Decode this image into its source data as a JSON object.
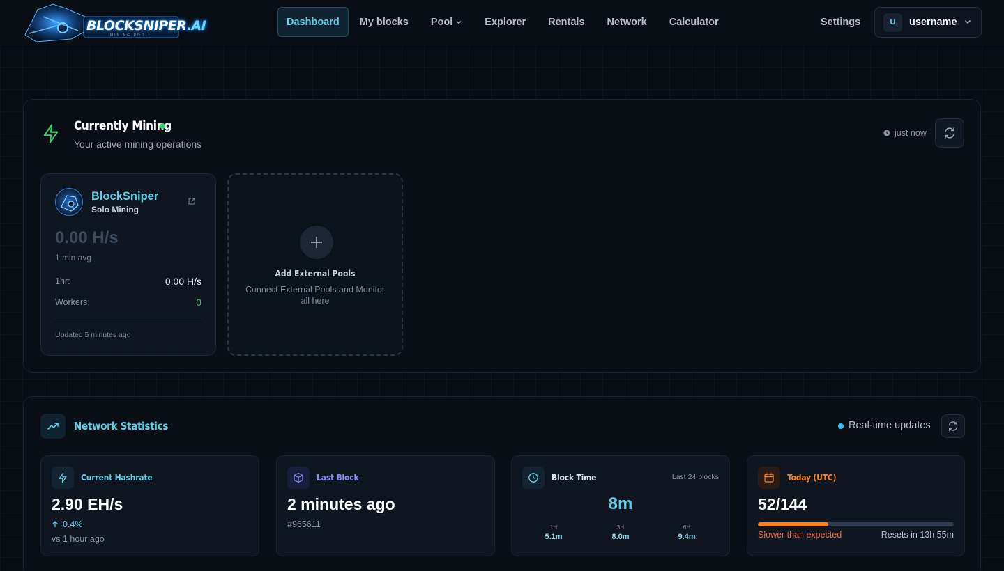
{
  "brand": {
    "logo_text": "BLOCKSNIPER",
    "logo_ai": ".AI",
    "logo_sub": "MINING POOL"
  },
  "nav": {
    "links": [
      {
        "label": "Dashboard",
        "active": true
      },
      {
        "label": "My blocks"
      },
      {
        "label": "Pool",
        "dropdown": true
      },
      {
        "label": "Explorer"
      },
      {
        "label": "Rentals"
      },
      {
        "label": "Network"
      },
      {
        "label": "Calculator"
      }
    ],
    "settings": "Settings",
    "user": {
      "initial": "U",
      "name": "username"
    }
  },
  "mining": {
    "title": "Currently Mining",
    "subtitle": "Your active mining operations",
    "updated": "just now",
    "pool": {
      "name": "BlockSniper",
      "type": "Solo Mining",
      "hashrate": "0.00 H/s",
      "hashrate_label": "1 min avg",
      "hr_label": "1hr:",
      "hr_value": "0.00 H/s",
      "workers_label": "Workers:",
      "workers_value": "0",
      "updated": "Updated 5 minutes ago"
    },
    "add": {
      "title": "Add External Pools",
      "subtitle": "Connect External Pools and Monitor all here"
    }
  },
  "network": {
    "title": "Network Statistics",
    "realtime": "Real-time updates",
    "hashrate": {
      "title": "Current Hashrate",
      "value": "2.90 EH/s",
      "change": "0.4%",
      "compare": "vs 1 hour ago"
    },
    "last_block": {
      "title": "Last Block",
      "value": "2 minutes ago",
      "height": "#965611"
    },
    "block_time": {
      "title": "Block Time",
      "note": "Last 24 blocks",
      "value": "8m",
      "cols": [
        {
          "k": "1H",
          "v": "5.1m"
        },
        {
          "k": "3H",
          "v": "8.0m"
        },
        {
          "k": "6H",
          "v": "9.4m"
        }
      ]
    },
    "today": {
      "title": "Today (UTC)",
      "value": "52/144",
      "progress": 0.361,
      "status": "Slower than expected",
      "reset": "Resets in 13h 55m"
    }
  },
  "colors": {
    "accent": "#5fcfea",
    "green": "#3ecf6e",
    "orange": "#f5821f",
    "indigo": "#818cf8"
  }
}
